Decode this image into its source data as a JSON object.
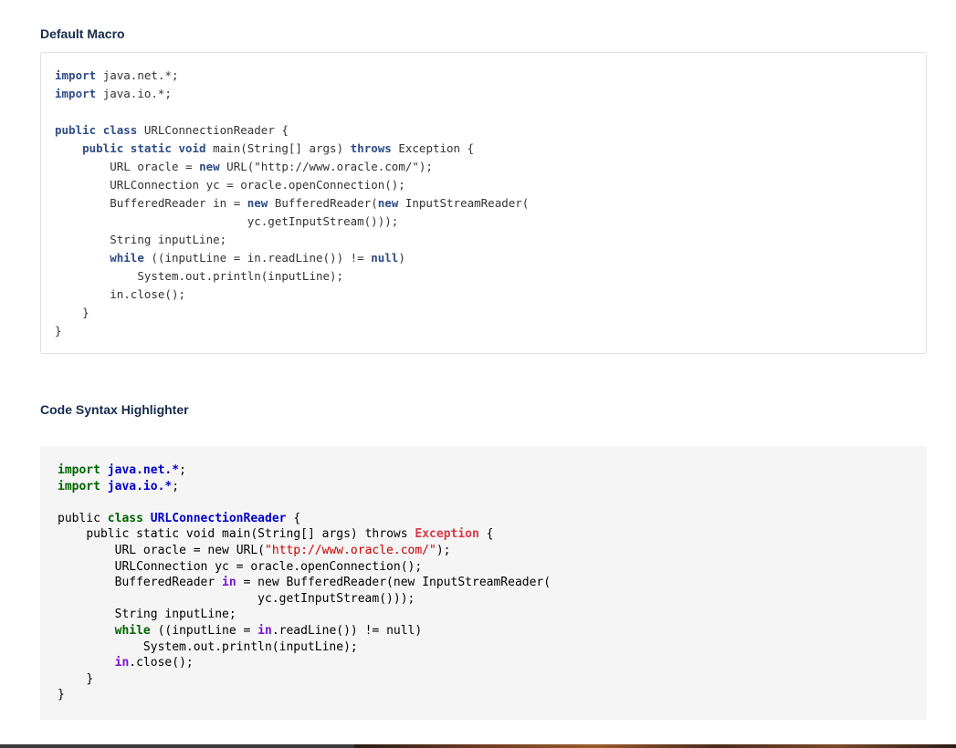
{
  "sections": {
    "default_macro_title": "Default Macro",
    "syntax_highlighter_title": "Code Syntax Highlighter"
  },
  "code": {
    "import": "import",
    "public": "public",
    "class": "class",
    "static": "static",
    "void": "void",
    "throws": "throws",
    "new": "new",
    "while": "while",
    "null": "null",
    "java_net": "java.net.*",
    "java_io": "java.io.*",
    "semi": ";",
    "class_name": "URLConnectionReader",
    "open_brace": "{",
    "close_brace": "}",
    "main_sig": "main(String[] args)",
    "exception": "Exception",
    "url_decl": "URL oracle = ",
    "url_ctor": "URL(",
    "url_string": "\"http://www.oracle.com/\"",
    "url_end": ");",
    "urlconn_line": "URLConnection yc = oracle.openConnection();",
    "br_decl_a": "BufferedReader ",
    "in_var": "in",
    "br_decl_b": " = ",
    "br_ctor_a": "BufferedReader(",
    "isr_ctor": "InputStreamReader(",
    "getstream_line": "yc.getInputStream()));",
    "string_decl": "String inputLine;",
    "while_a": "((inputLine = ",
    "readline": ".readLine()) != ",
    "while_end": ")",
    "println_line": "System.out.println(inputLine);",
    "close_call": ".close();"
  },
  "colors": {
    "default_keyword": "#2f4c86",
    "syntax_keyword": "#006400",
    "syntax_type": "#0000cc",
    "syntax_exception": "#d73a49",
    "syntax_string": "#cc0000",
    "syntax_in": "#7a12d6",
    "syntax_background": "#f5f5f5"
  }
}
